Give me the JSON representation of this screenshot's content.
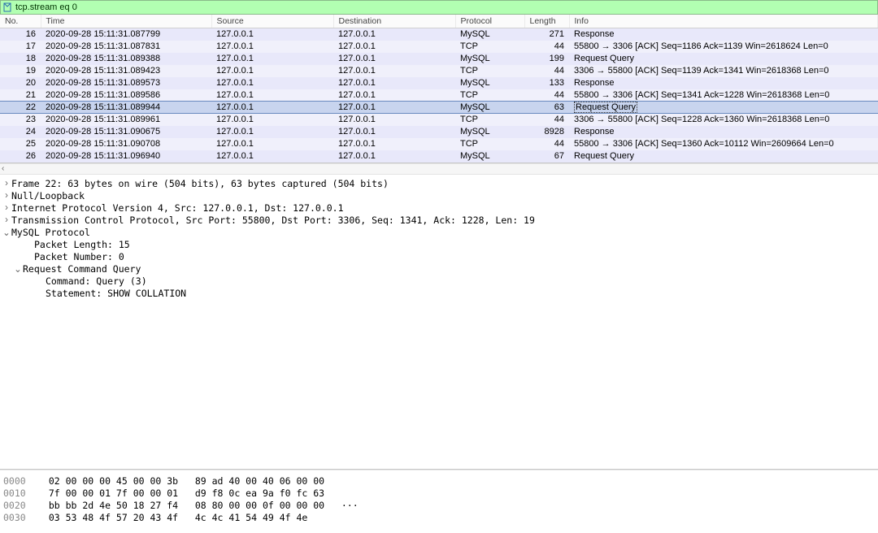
{
  "filter": {
    "value": "tcp.stream eq 0"
  },
  "columns": {
    "no": "No.",
    "time": "Time",
    "src": "Source",
    "dst": "Destination",
    "proto": "Protocol",
    "len": "Length",
    "info": "Info"
  },
  "packets": [
    {
      "no": "16",
      "time": "2020-09-28 15:11:31.087799",
      "src": "127.0.0.1",
      "dst": "127.0.0.1",
      "proto": "MySQL",
      "len": "271",
      "info": "Response",
      "cls": "row-light"
    },
    {
      "no": "17",
      "time": "2020-09-28 15:11:31.087831",
      "src": "127.0.0.1",
      "dst": "127.0.0.1",
      "proto": "TCP",
      "len": "44",
      "info": "55800 → 3306 [ACK] Seq=1186 Ack=1139 Win=2618624 Len=0",
      "cls": "row-lighter"
    },
    {
      "no": "18",
      "time": "2020-09-28 15:11:31.089388",
      "src": "127.0.0.1",
      "dst": "127.0.0.1",
      "proto": "MySQL",
      "len": "199",
      "info": "Request Query",
      "cls": "row-light"
    },
    {
      "no": "19",
      "time": "2020-09-28 15:11:31.089423",
      "src": "127.0.0.1",
      "dst": "127.0.0.1",
      "proto": "TCP",
      "len": "44",
      "info": "3306 → 55800 [ACK] Seq=1139 Ack=1341 Win=2618368 Len=0",
      "cls": "row-lighter"
    },
    {
      "no": "20",
      "time": "2020-09-28 15:11:31.089573",
      "src": "127.0.0.1",
      "dst": "127.0.0.1",
      "proto": "MySQL",
      "len": "133",
      "info": "Response",
      "cls": "row-light"
    },
    {
      "no": "21",
      "time": "2020-09-28 15:11:31.089586",
      "src": "127.0.0.1",
      "dst": "127.0.0.1",
      "proto": "TCP",
      "len": "44",
      "info": "55800 → 3306 [ACK] Seq=1341 Ack=1228 Win=2618368 Len=0",
      "cls": "row-lighter"
    },
    {
      "no": "22",
      "time": "2020-09-28 15:11:31.089944",
      "src": "127.0.0.1",
      "dst": "127.0.0.1",
      "proto": "MySQL",
      "len": "63",
      "info": "Request Query",
      "cls": "row-selected",
      "selected": true
    },
    {
      "no": "23",
      "time": "2020-09-28 15:11:31.089961",
      "src": "127.0.0.1",
      "dst": "127.0.0.1",
      "proto": "TCP",
      "len": "44",
      "info": "3306 → 55800 [ACK] Seq=1228 Ack=1360 Win=2618368 Len=0",
      "cls": "row-lighter"
    },
    {
      "no": "24",
      "time": "2020-09-28 15:11:31.090675",
      "src": "127.0.0.1",
      "dst": "127.0.0.1",
      "proto": "MySQL",
      "len": "8928",
      "info": "Response",
      "cls": "row-light"
    },
    {
      "no": "25",
      "time": "2020-09-28 15:11:31.090708",
      "src": "127.0.0.1",
      "dst": "127.0.0.1",
      "proto": "TCP",
      "len": "44",
      "info": "55800 → 3306 [ACK] Seq=1360 Ack=10112 Win=2609664 Len=0",
      "cls": "row-lighter"
    },
    {
      "no": "26",
      "time": "2020-09-28 15:11:31.096940",
      "src": "127.0.0.1",
      "dst": "127.0.0.1",
      "proto": "MySQL",
      "len": "67",
      "info": "Request Query",
      "cls": "row-light"
    }
  ],
  "details": [
    {
      "exp": ">",
      "indent": 0,
      "text": "Frame 22: 63 bytes on wire (504 bits), 63 bytes captured (504 bits)"
    },
    {
      "exp": ">",
      "indent": 0,
      "text": "Null/Loopback"
    },
    {
      "exp": ">",
      "indent": 0,
      "text": "Internet Protocol Version 4, Src: 127.0.0.1, Dst: 127.0.0.1"
    },
    {
      "exp": ">",
      "indent": 0,
      "text": "Transmission Control Protocol, Src Port: 55800, Dst Port: 3306, Seq: 1341, Ack: 1228, Len: 19"
    },
    {
      "exp": "v",
      "indent": 0,
      "text": "MySQL Protocol"
    },
    {
      "exp": "",
      "indent": 2,
      "text": "Packet Length: 15"
    },
    {
      "exp": "",
      "indent": 2,
      "text": "Packet Number: 0"
    },
    {
      "exp": "v",
      "indent": 1,
      "text": "Request Command Query"
    },
    {
      "exp": "",
      "indent": 3,
      "text": "Command: Query (3)"
    },
    {
      "exp": "",
      "indent": 3,
      "text": "Statement: SHOW COLLATION"
    }
  ],
  "hex": [
    {
      "off": "0000",
      "b1": "02 00 00 00 45 00 00 3b",
      "b2": "89 ad 40 00 40 06 00 00",
      "asc": ""
    },
    {
      "off": "0010",
      "b1": "7f 00 00 01 7f 00 00 01",
      "b2": "d9 f8 0c ea 9a f0 fc 63",
      "asc": ""
    },
    {
      "off": "0020",
      "b1": "bb bb 2d 4e 50 18 27 f4",
      "b2": "08 80 00 00 0f 00 00 00",
      "asc": "···"
    },
    {
      "off": "0030",
      "b1": "03 53 48 4f 57 20 43 4f",
      "b2": "4c 4c 41 54 49 4f 4e",
      "asc": ""
    }
  ]
}
